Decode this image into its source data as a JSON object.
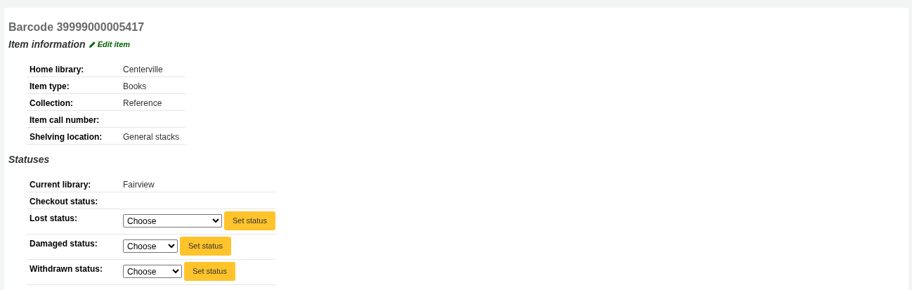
{
  "title": "Barcode 39999000005417",
  "item_information": {
    "heading": "Item information",
    "edit_link": "Edit item",
    "rows": [
      {
        "label": "Home library:",
        "value": "Centerville"
      },
      {
        "label": "Item type:",
        "value": "Books"
      },
      {
        "label": "Collection:",
        "value": "Reference"
      },
      {
        "label": "Item call number:"
      },
      {
        "label": "Shelving location:",
        "value": "General stacks"
      }
    ]
  },
  "statuses": {
    "heading": "Statuses",
    "rows": [
      {
        "kind": "text",
        "label": "Current library:",
        "value": "Fairview"
      },
      {
        "kind": "text",
        "label": "Checkout status:"
      },
      {
        "kind": "select",
        "label": "Lost status:",
        "selected_option": "Choose",
        "button": "Set status"
      },
      {
        "kind": "select",
        "label": "Damaged status:",
        "selected_option": "Choose",
        "button": "Set status"
      },
      {
        "kind": "select",
        "label": "Withdrawn status:",
        "selected_option": "Choose",
        "button": "Set status"
      }
    ]
  }
}
